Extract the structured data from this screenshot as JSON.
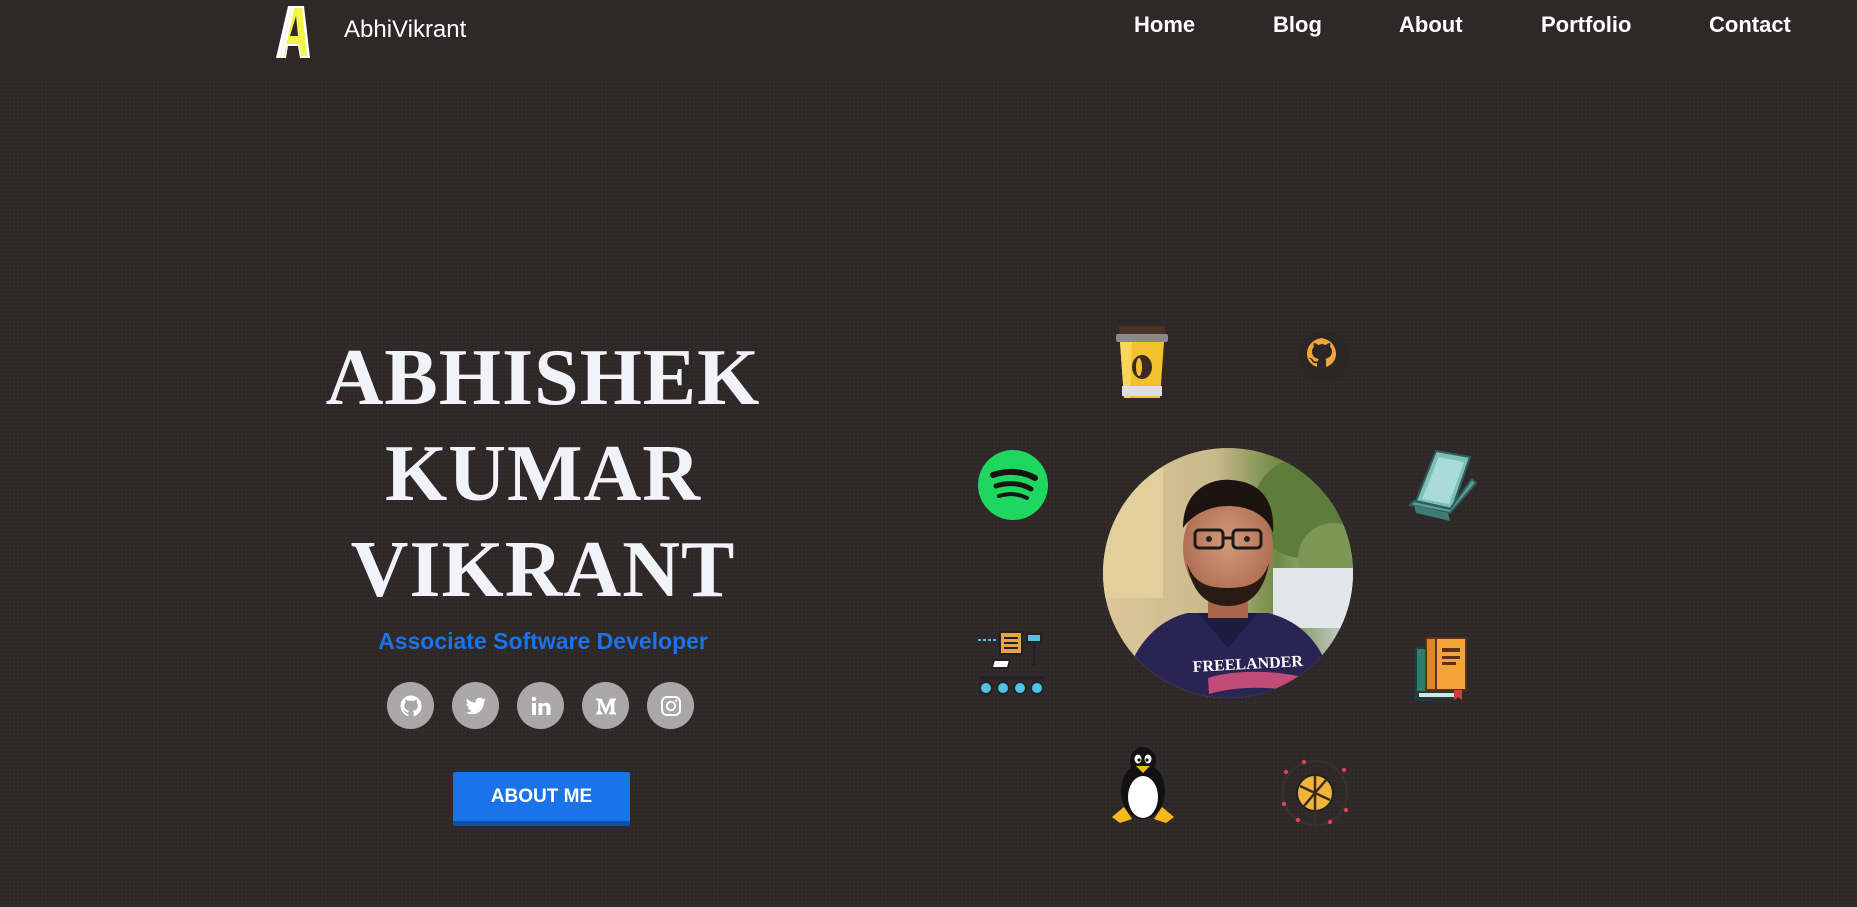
{
  "nav": {
    "logo_letter": "A",
    "brand": "AbhiVikrant",
    "links": [
      "Home",
      "Blog",
      "About",
      "Portfolio",
      "Contact"
    ]
  },
  "hero": {
    "name_lines": [
      "ABHISHEK",
      "KUMAR",
      "VIKRANT"
    ],
    "subtitle": "Associate Software Developer",
    "social_icons": [
      "github-icon",
      "twitter-icon",
      "linkedin-icon",
      "medium-icon",
      "instagram-icon"
    ],
    "cta_label": "ABOUT ME",
    "avatar_shirt_text": "FREELANDER",
    "orbit_icons": [
      "coffee-cup-icon",
      "github-octocat-icon",
      "spotify-icon",
      "laptop-icon",
      "conveyor-pipeline-icon",
      "books-icon",
      "linux-tux-icon",
      "network-globe-icon"
    ]
  },
  "colors": {
    "background": "#2f2828",
    "accent": "#1a73e8",
    "text": "#f2f3f8",
    "social_bg": "#a9a7a7",
    "logo_yellow": "#f4f44a",
    "spotify_green": "#1ed760"
  }
}
